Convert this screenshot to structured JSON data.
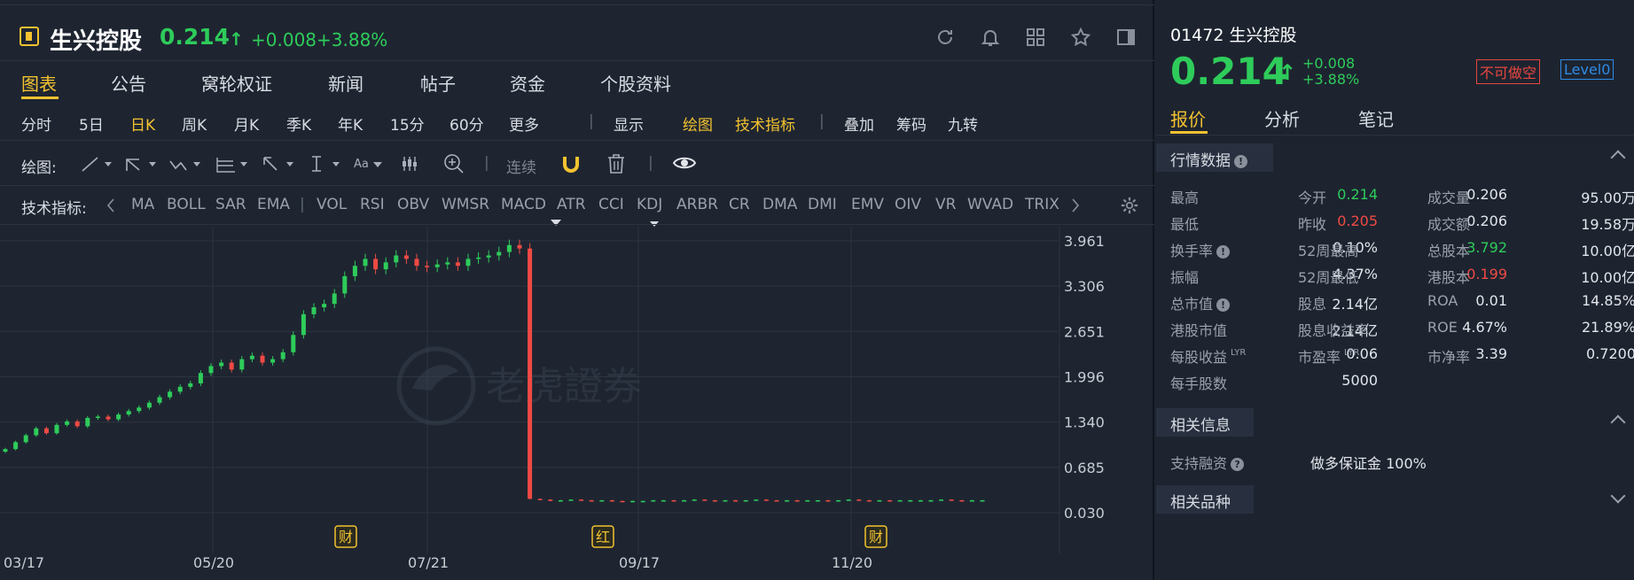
{
  "header": {
    "name": "生兴控股",
    "price": "0.214",
    "arrow": "↑",
    "change": "+0.008",
    "change_pct": "+3.88%"
  },
  "tabs": [
    "图表",
    "公告",
    "窝轮权证",
    "新闻",
    "帖子",
    "资金",
    "个股资料"
  ],
  "periods": {
    "items": [
      "分时",
      "5日",
      "日K",
      "周K",
      "月K",
      "季K",
      "年K",
      "15分",
      "60分",
      "更多"
    ],
    "display": "显示",
    "draw": "绘图",
    "indicators": "技术指标",
    "overlay": "叠加",
    "chips": "筹码",
    "nine": "九转"
  },
  "drawbar": {
    "label": "绘图:",
    "continuous": "连续",
    "text_tool": "Aa"
  },
  "indicator_bar": {
    "label": "技术指标:",
    "items": [
      "MA",
      "BOLL",
      "SAR",
      "EMA",
      "VOL",
      "RSI",
      "OBV",
      "WMSR",
      "MACD",
      "ATR",
      "CCI",
      "KDJ",
      "ARBR",
      "CR",
      "DMA",
      "DMI",
      "EMV",
      "OIV",
      "VR",
      "WVAD",
      "TRIX"
    ]
  },
  "chart_data": {
    "type": "candlestick",
    "x_ticks": [
      "03/17",
      "05/20",
      "07/21",
      "09/17",
      "11/20"
    ],
    "y_ticks": [
      "3.961",
      "3.306",
      "2.651",
      "1.996",
      "1.340",
      "0.685",
      "0.030"
    ],
    "ylim": [
      0.03,
      3.961
    ],
    "markers": [
      {
        "label": "财",
        "date": "06/18"
      },
      {
        "label": "红",
        "date": "09/04"
      },
      {
        "label": "财",
        "date": "11/28"
      }
    ],
    "watermark": "老虎證券",
    "series": [
      {
        "name": "close",
        "values": [
          0.95,
          1.05,
          1.15,
          1.25,
          1.18,
          1.3,
          1.35,
          1.28,
          1.4,
          1.42,
          1.38,
          1.45,
          1.5,
          1.55,
          1.62,
          1.7,
          1.78,
          1.85,
          1.9,
          2.05,
          2.15,
          2.2,
          2.1,
          2.25,
          2.3,
          2.2,
          2.25,
          2.35,
          2.6,
          2.9,
          3.0,
          3.05,
          3.2,
          3.45,
          3.6,
          3.7,
          3.55,
          3.65,
          3.75,
          3.7,
          3.6,
          3.58,
          3.62,
          3.65,
          3.6,
          3.7,
          3.72,
          3.75,
          3.8,
          3.9,
          3.85,
          0.23,
          0.22,
          0.2,
          0.21,
          0.22,
          0.21,
          0.2,
          0.21,
          0.2,
          0.19,
          0.2,
          0.2,
          0.21,
          0.21,
          0.2,
          0.21,
          0.22,
          0.21,
          0.2,
          0.21,
          0.2,
          0.21,
          0.22,
          0.21,
          0.2,
          0.21,
          0.2,
          0.21,
          0.21,
          0.2,
          0.21,
          0.22,
          0.21,
          0.2,
          0.21,
          0.2,
          0.21,
          0.21,
          0.21,
          0.21,
          0.22,
          0.21,
          0.2,
          0.21,
          0.21
        ]
      }
    ]
  },
  "quote_panel": {
    "title": "01472 生兴控股",
    "price": "0.214",
    "arrow": "↑",
    "change": "+0.008",
    "change_pct": "+3.88%",
    "badge_short": "不可做空",
    "badge_level": "Level0",
    "tabs": [
      "报价",
      "分析",
      "笔记"
    ],
    "section_market": "行情数据",
    "rows": [
      [
        [
          "最高",
          "0.214",
          "g"
        ],
        [
          "今开",
          "0.206",
          ""
        ],
        [
          "成交量",
          "95.00万",
          ""
        ]
      ],
      [
        [
          "最低",
          "0.205",
          "r"
        ],
        [
          "昨收",
          "0.206",
          ""
        ],
        [
          "成交额",
          "19.58万",
          ""
        ]
      ],
      [
        [
          "换手率",
          "0.10%",
          ""
        ],
        [
          "52周最高",
          "3.792",
          "g"
        ],
        [
          "总股本",
          "10.00亿",
          ""
        ]
      ],
      [
        [
          "振幅",
          "4.37%",
          ""
        ],
        [
          "52周最低",
          "0.199",
          "r"
        ],
        [
          "港股本",
          "10.00亿",
          ""
        ]
      ],
      [
        [
          "总市值",
          "2.14亿",
          ""
        ],
        [
          "股息",
          "0.01",
          ""
        ],
        [
          "ROA",
          "14.85%",
          ""
        ]
      ],
      [
        [
          "港股市值",
          "2.14亿",
          ""
        ],
        [
          "股息收益率",
          "4.67%",
          ""
        ],
        [
          "ROE",
          "21.89%",
          ""
        ]
      ],
      [
        [
          "每股收益",
          "0.06",
          ""
        ],
        [
          "市盈率",
          "3.39",
          ""
        ],
        [
          "市净率",
          "0.7200",
          ""
        ]
      ],
      [
        [
          "每手股数",
          "5000",
          ""
        ]
      ]
    ],
    "sup_lyr": "LYR",
    "section_related": "相关信息",
    "margin_label": "支持融资",
    "margin_value": "做多保证金 100%",
    "section_products": "相关品种"
  }
}
